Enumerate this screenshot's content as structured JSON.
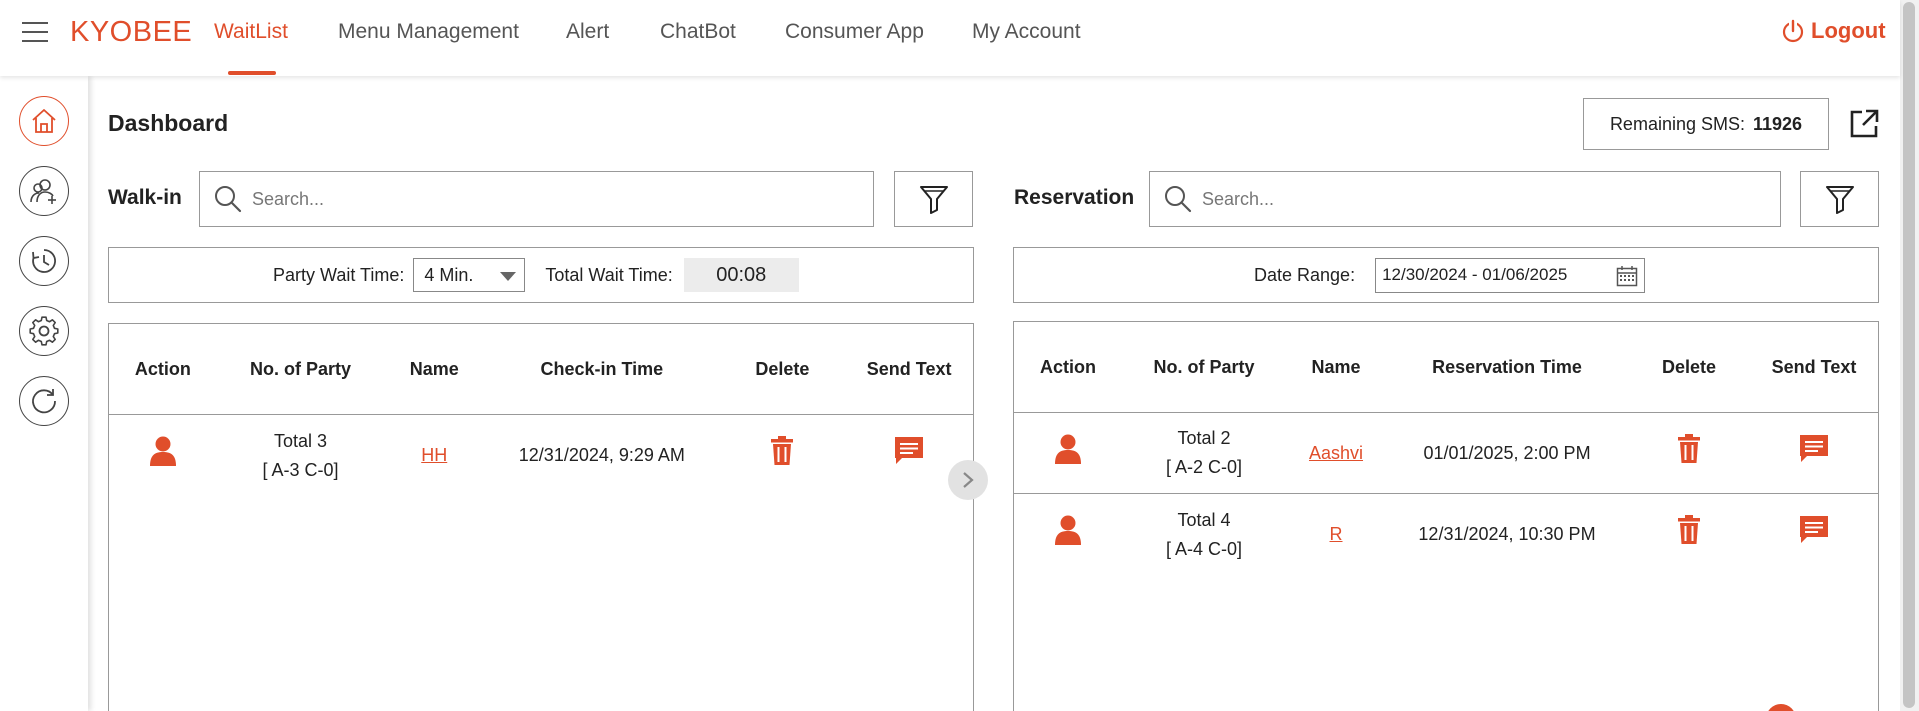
{
  "brand": "KYOBEE",
  "nav": {
    "items": [
      {
        "label": "WaitList",
        "active": true
      },
      {
        "label": "Menu Management"
      },
      {
        "label": "Alert"
      },
      {
        "label": "ChatBot"
      },
      {
        "label": "Consumer App"
      },
      {
        "label": "My Account"
      }
    ],
    "logout_label": "Logout"
  },
  "sidebar": {
    "items": [
      {
        "icon": "home-icon",
        "active": true
      },
      {
        "icon": "add-user-icon"
      },
      {
        "icon": "history-icon"
      },
      {
        "icon": "gear-icon"
      },
      {
        "icon": "refresh-icon"
      }
    ]
  },
  "dashboard": {
    "title": "Dashboard",
    "sms_label": "Remaining SMS:",
    "sms_value": "11926"
  },
  "walkin": {
    "label": "Walk-in",
    "search_placeholder": "Search...",
    "party_wait_label": "Party Wait Time:",
    "party_wait_value": "4 Min.",
    "total_wait_label": "Total Wait Time:",
    "total_wait_value": "00:08",
    "columns": [
      "Action",
      "No. of Party",
      "Name",
      "Check-in Time",
      "Delete",
      "Send Text"
    ],
    "rows": [
      {
        "party_total": "Total 3",
        "party_detail": "[ A-3 C-0]",
        "name": "HH",
        "time": "12/31/2024, 9:29 AM"
      }
    ]
  },
  "reservation": {
    "label": "Reservation",
    "search_placeholder": "Search...",
    "date_range_label": "Date Range:",
    "date_range_value": "12/30/2024 - 01/06/2025",
    "columns": [
      "Action",
      "No. of Party",
      "Name",
      "Reservation Time",
      "Delete",
      "Send Text"
    ],
    "rows": [
      {
        "party_total": "Total 2",
        "party_detail": "[ A-2 C-0]",
        "name": "Aashvi",
        "time": "01/01/2025, 2:00 PM"
      },
      {
        "party_total": "Total 4",
        "party_detail": "[ A-4 C-0]",
        "name": "R",
        "time": "12/31/2024, 10:30 PM"
      }
    ]
  },
  "colors": {
    "accent": "#e04e2b",
    "border": "#999999",
    "text": "#222222"
  }
}
